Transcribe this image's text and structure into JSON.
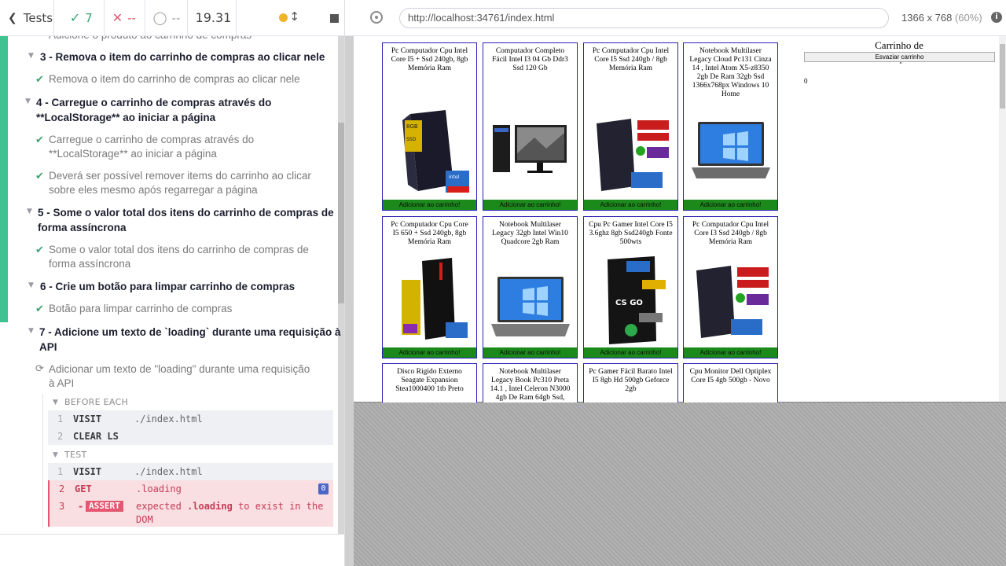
{
  "stats": {
    "tests_label": "Tests",
    "passed": "7",
    "failed": "--",
    "pending": "--",
    "duration": "19.31"
  },
  "colors": {
    "pass": "#3aa26e",
    "fail": "#e45770",
    "command_error_bg": "#f9dee2",
    "product_border": "#2b1fb8",
    "button_green": "#1b8a1b"
  },
  "runnables": {
    "partial_top": "Adicione o produto ao carrinho de compras",
    "suites": [
      {
        "title": "3 - Remova o item do carrinho de compras ao clicar nele",
        "tests": [
          "Remova o item do carrinho de compras ao clicar nele"
        ]
      },
      {
        "title_l1": "4 - Carregue o carrinho de compras através do",
        "title_l2": "**LocalStorage** ao iniciar a página",
        "tests": [
          {
            "l1": "Carregue o carrinho de compras através do",
            "l2": "**LocalStorage** ao iniciar a página"
          },
          {
            "l1": "Deverá ser possível remover items do carrinho ao clicar",
            "l2": "sobre eles mesmo após regarregar a página"
          }
        ]
      },
      {
        "title_l1": "5 - Some o valor total dos itens do carrinho de compras de",
        "title_l2": "forma assíncrona",
        "tests": [
          {
            "l1": "Some o valor total dos itens do carrinho de compras de",
            "l2": "forma assíncrona"
          }
        ]
      },
      {
        "title": "6 - Crie um botão para limpar carrinho de compras",
        "tests": [
          "Botão para limpar carrinho de compras"
        ]
      },
      {
        "title_l1": "7 - Adicione um texto de `loading` durante uma requisição à",
        "title_l2": "API",
        "tests": [
          {
            "l1": "Adicionar um texto de \"loading\" durante uma requisição",
            "l2": "à API"
          }
        ]
      }
    ],
    "before_each_label": "BEFORE EACH",
    "test_label": "TEST",
    "before_each": [
      {
        "num": "1",
        "name": "VISIT",
        "msg": "./index.html"
      },
      {
        "num": "2",
        "name": "CLEAR LS",
        "msg": ""
      }
    ],
    "test_cmds": [
      {
        "num": "1",
        "name": "VISIT",
        "msg": "./index.html"
      },
      {
        "num": "2",
        "name": "GET",
        "msg": ".loading",
        "badge": "0"
      },
      {
        "num": "3",
        "name": "ASSERT",
        "prefix": "-",
        "msg_l1": "expected .loading to exist in the",
        "msg_l2": "DOM",
        "emph": ".loading"
      }
    ]
  },
  "browser": {
    "url": "http://localhost:34761/index.html",
    "viewport": "1366 x 768",
    "scale": "(60%)"
  },
  "products": [
    {
      "title": "Pc Computador Cpu Intel Core I5 + Ssd 240gb, 8gb Memória Ram",
      "button": "Adicionar ao carrinho!"
    },
    {
      "title": "Computador Completo Fácil Intel I3 04 Gb Ddr3 Ssd 120 Gb",
      "button": "Adicionar ao carrinho!"
    },
    {
      "title": "Pc Computador Cpu Intel Core I5 Ssd 240gb / 8gb Memória Ram",
      "button": "Adicionar ao carrinho!"
    },
    {
      "title": "Notebook Multilaser Legacy Cloud Pc131 Cinza 14 , Intel Atom X5-z8350 2gb De Ram 32gb Ssd 1366x768px Windows 10 Home",
      "button": "Adicionar ao carrinho!"
    },
    {
      "title": "Pc Computador Cpu Core I5 650 + Ssd 240gb, 8gb Memória Ram",
      "button": "Adicionar ao carrinho!"
    },
    {
      "title": "Notebook Multilaser Legacy 32gb Intel Win10 Quadcore 2gb Ram",
      "button": "Adicionar ao carrinho!"
    },
    {
      "title": "Cpu Pc Gamer Intel Core I5 3.6ghz 8gb Ssd240gb Fonte 500wts",
      "button": "Adicionar ao carrinho!"
    },
    {
      "title": "Pc Computador Cpu Intel Core I3 Ssd 240gb / 8gb Memória Ram",
      "button": "Adicionar ao carrinho!"
    },
    {
      "title": "Disco Rigido Externo Seagate Expansion Stea1000400 1tb Preto",
      "button": ""
    },
    {
      "title": "Notebook Multilaser Legacy Book Pc310 Preta 14.1 , Intel Celeron N3000 4gb De Ram 64gb Ssd,",
      "button": ""
    },
    {
      "title": "Pc Gamer Fácil Barato Intel I5 8gb Hd 500gb Geforce 2gb",
      "button": ""
    },
    {
      "title": "Cpu Monitor Dell Optiplex Core I5 4gb 500gb - Novo",
      "button": ""
    }
  ],
  "cart": {
    "title": "Carrinho de compras",
    "empty_button": "Esvaziar carrinho",
    "total": "0"
  }
}
